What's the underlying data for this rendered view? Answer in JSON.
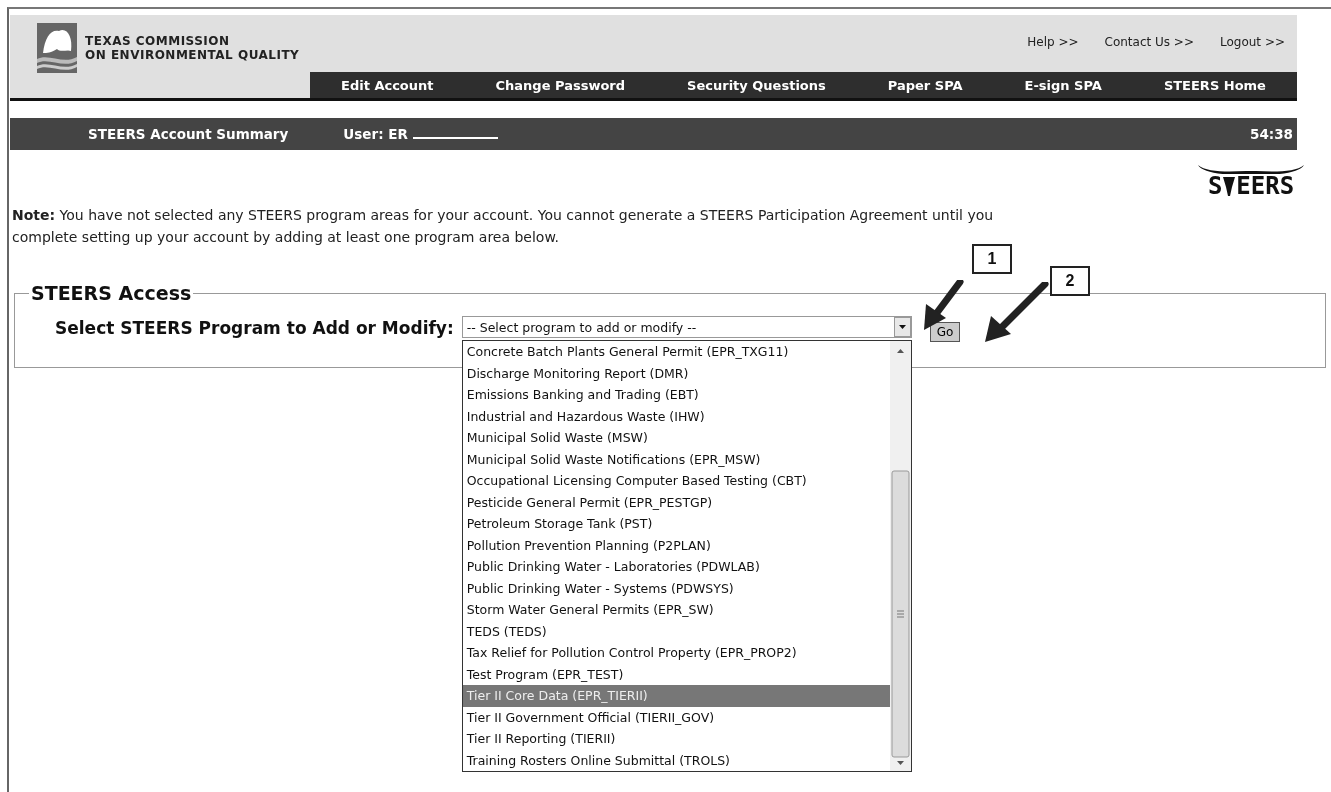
{
  "header": {
    "agency_name": [
      "TEXAS COMMISSION",
      "ON ENVIRONMENTAL QUALITY"
    ],
    "top_links": [
      "Help >>",
      "Contact Us >>",
      "Logout >>"
    ],
    "nav": [
      "Edit Account",
      "Change Password",
      "Security Questions",
      "Paper SPA",
      "E-sign SPA",
      "STEERS Home"
    ]
  },
  "summary_bar": {
    "title": "STEERS Account Summary",
    "user": "User: ER",
    "timer": "54:38"
  },
  "logo": {
    "first": "S",
    "rest": "EERS"
  },
  "note": "**Note:** You have not selected any STEERS program areas for your account. You cannot generate a STEERS Participation Agreement until you complete setting up your account by adding at least one program area below.",
  "access": {
    "legend": "STEERS Access",
    "label": "Select STEERS Program to Add or Modify:",
    "value": "-- Select program to add or modify --",
    "button": "Go",
    "options": [
      {
        "label": "Concrete Batch Plants General Permit (EPR_TXG11)",
        "selected": false
      },
      {
        "label": "Discharge Monitoring Report (DMR)",
        "selected": false
      },
      {
        "label": "Emissions Banking and Trading (EBT)",
        "selected": false
      },
      {
        "label": "Industrial and Hazardous Waste (IHW)",
        "selected": false
      },
      {
        "label": "Municipal Solid Waste (MSW)",
        "selected": false
      },
      {
        "label": "Municipal Solid Waste Notifications (EPR_MSW)",
        "selected": false
      },
      {
        "label": "Occupational Licensing Computer Based Testing (CBT)",
        "selected": false
      },
      {
        "label": "Pesticide General Permit (EPR_PESTGP)",
        "selected": false
      },
      {
        "label": "Petroleum Storage Tank (PST)",
        "selected": false
      },
      {
        "label": "Pollution Prevention Planning (P2PLAN)",
        "selected": false
      },
      {
        "label": "Public Drinking Water - Laboratories (PDWLAB)",
        "selected": false
      },
      {
        "label": "Public Drinking Water - Systems (PDWSYS)",
        "selected": false
      },
      {
        "label": "Storm Water General Permits (EPR_SW)",
        "selected": false
      },
      {
        "label": "TEDS (TEDS)",
        "selected": false
      },
      {
        "label": "Tax Relief for Pollution Control Property (EPR_PROP2)",
        "selected": false
      },
      {
        "label": "Test Program (EPR_TEST)",
        "selected": false
      },
      {
        "label": "Tier II Core Data (EPR_TIERII)",
        "selected": true
      },
      {
        "label": "Tier II Government Official (TIERII_GOV)",
        "selected": false
      },
      {
        "label": "Tier II Reporting (TIERII)",
        "selected": false
      },
      {
        "label": "Training Rosters Online Submittal (TROLS)",
        "selected": false
      }
    ]
  },
  "callouts": [
    {
      "label": "1"
    },
    {
      "label": "2"
    }
  ]
}
